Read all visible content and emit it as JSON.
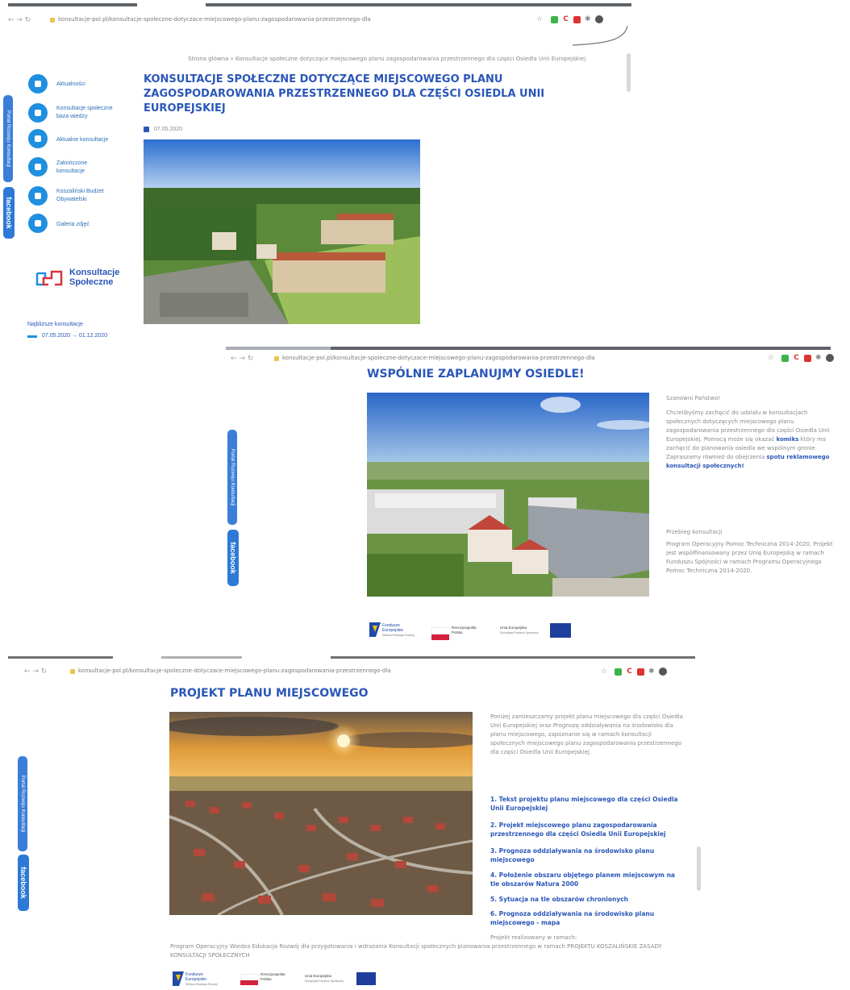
{
  "screens": [
    {
      "address": "konsultacje-pol.pl/konsultacje-spoleczne-dotyczace-miejscowego-planu-zagospodarowania-przestrzennego-dla",
      "breadcrumb": "Strona główna » Konsultacje społeczne dotyczące miejscowego planu zagospodarowania przestrzennego dla części Osiedla Unii Europejskiej",
      "title": "KONSULTACJE SPOŁECZNE DOTYCZĄCE MIEJSCOWEGO PLANU ZAGOSPODAROWANIA PRZESTRZENNEGO DLA CZĘŚCI OSIEDLA UNII EUROPEJSKIEJ",
      "date": "07.05.2020",
      "sidebar": [
        {
          "label": "Aktualności",
          "icon": "megaphone-icon"
        },
        {
          "label": "Konsultacje społeczne baza wiedzy",
          "icon": "book-icon"
        },
        {
          "label": "Aktualne konsultacje",
          "icon": "chat-icon"
        },
        {
          "label": "Zakończone konsultacje",
          "icon": "check-icon"
        },
        {
          "label": "Koszaliński Budżet Obywatelski",
          "icon": "wallet-icon"
        },
        {
          "label": "Galeria zdjęć",
          "icon": "camera-icon"
        }
      ],
      "logo_text_1": "Konsultacje",
      "logo_text_2": "Społeczne",
      "upcoming_label": "Najbliższe konsultacje",
      "upcoming_range": "07.05.2020 → 01.12.2020",
      "facebook": "facebook",
      "side_tab": "Portal Rozwoju Konsultacji"
    },
    {
      "address": "konsultacje-pol.pl/konsultacje-spoleczne-dotyczace-miejscowego-planu-zagospodarowania-przestrzennego-dla",
      "title": "WSPÓLNIE ZAPLANUJMY OSIEDLE!",
      "greeting": "Szanowni Państwo!",
      "paragraph_a": "Chcielibyśmy zachęcić do udziału w konsultacjach społecznych dotyczących miejscowego planu zagospodarowania przestrzennego dla części Osiedla Unii Europejskiej. Pomocą może się okazać",
      "link_comic": "komiks",
      "paragraph_b": "który ma zachęcić do planowania osiedla we wspólnym gronie. Zapraszamy również do obejrzenia",
      "link_spot": "spotu reklamowego konsultacji społecznych!",
      "section2_title": "Przebieg konsultacji",
      "section2_text": "Program Operacyjny Pomoc Techniczna 2014-2020. Projekt jest współfinansowany przez Unię Europejską w ramach Funduszu Spójności w ramach Programu Operacyjnego Pomoc Techniczna 2014-2020.",
      "facebook": "facebook",
      "side_tab": "Portal Rozwoju Konsultacji"
    },
    {
      "address": "konsultacje-pol.pl/konsultacje-spoleczne-dotyczace-miejscowego-planu-zagospodarowania-przestrzennego-dla",
      "title": "PROJEKT PLANU MIEJSCOWEGO",
      "intro": "Poniżej zamieszczamy projekt planu miejscowego dla części Osiedla Unii Europejskiej oraz Prognozę oddziaływania na środowisko dla planu miejscowego, zapoznanie się w ramach konsultacji społecznych miejscowego planu zagospodarowania przestrzennego dla części Osiedla Unii Europejskiej.",
      "documents": [
        "1. Tekst projektu planu miejscowego dla części Osiedla Unii Europejskiej",
        "2. Projekt miejscowego planu zagospodarowania przestrzennego dla części Osiedla Unii Europejskiej",
        "3. Prognoza oddziaływania na środowisko planu miejscowego",
        "4. Położenie obszaru objętego planem miejscowym na tle obszarów Natura 2000",
        "5. Sytuacja na tle obszarów chronionych",
        "6. Prognoza oddziaływania na środowisko planu miejscowego - mapa"
      ],
      "footnote_short": "Projekt realizowany w ramach:",
      "footer_text": "Program Operacyjny Wiedza Edukacja Rozwój dla przygotowania i wdrażania Konsultacji społecznych planowania przestrzennego w ramach PROJEKTU KOSZALIŃSKIE ZASADY KONSULTACJI SPOŁECZNYCH",
      "facebook": "facebook",
      "side_tab": "Portal Rozwoju Konsultacji"
    }
  ],
  "eu_logos": {
    "fund": "Fundusze Europejskie",
    "fund_sub": "Wiedza Edukacja Rozwój",
    "poland": "Rzeczpospolita Polska",
    "eu": "Unia Europejska",
    "eu_sub": "Europejski Fundusz Społeczny"
  },
  "colors": {
    "accent": "#1f8fe0",
    "heading": "#2a57b8",
    "facebook_tab": "#2c7ad6"
  }
}
